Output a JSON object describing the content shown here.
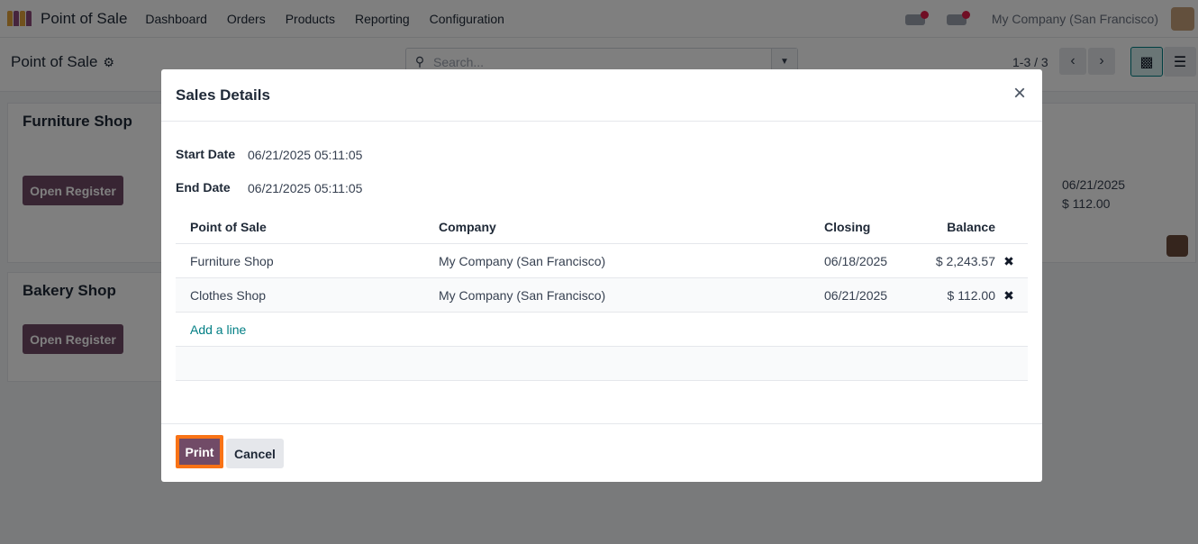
{
  "navbar": {
    "app_name": "Point of Sale",
    "menu": [
      "Dashboard",
      "Orders",
      "Products",
      "Reporting",
      "Configuration"
    ],
    "company": "My Company (San Francisco)",
    "icons": [
      "app-logo-icon",
      "messages-icon",
      "activity-icon",
      "user-avatar"
    ]
  },
  "control_panel": {
    "breadcrumb": "Point of Sale",
    "settings_icon": "⚙",
    "search_placeholder": "Search...",
    "search_icon": "🔍",
    "pager": "1-3 / 3",
    "prev_icon": "‹",
    "next_icon": "›",
    "kanban_icon": "▩",
    "list_icon": "☰"
  },
  "cards": [
    {
      "title": "Furniture Shop",
      "button": "Open Register"
    },
    {
      "title": "Bakery Shop",
      "button": "Open Register"
    },
    {
      "date": "06/21/2025",
      "amount": "$ 112.00"
    }
  ],
  "modal": {
    "title": "Sales Details",
    "close_icon": "×",
    "start_label": "Start Date",
    "start_value": "06/21/2025 05:11:05",
    "end_label": "End Date",
    "end_value": "06/21/2025 05:11:05",
    "table": {
      "headers": [
        "Point of Sale",
        "Company",
        "Closing",
        "Balance"
      ],
      "rows": [
        {
          "pos": "Furniture Shop",
          "company": "My Company (San Francisco)",
          "closing": "06/18/2025",
          "balance": "$ 2,243.57"
        },
        {
          "pos": "Clothes Shop",
          "company": "My Company (San Francisco)",
          "closing": "06/21/2025",
          "balance": "$ 112.00"
        }
      ],
      "delete_icon": "✖",
      "add_line": "Add a line"
    },
    "print_label": "Print",
    "cancel_label": "Cancel"
  },
  "colors": {
    "brand": "#714b67",
    "link": "#017e84",
    "highlight": "#f97316"
  }
}
